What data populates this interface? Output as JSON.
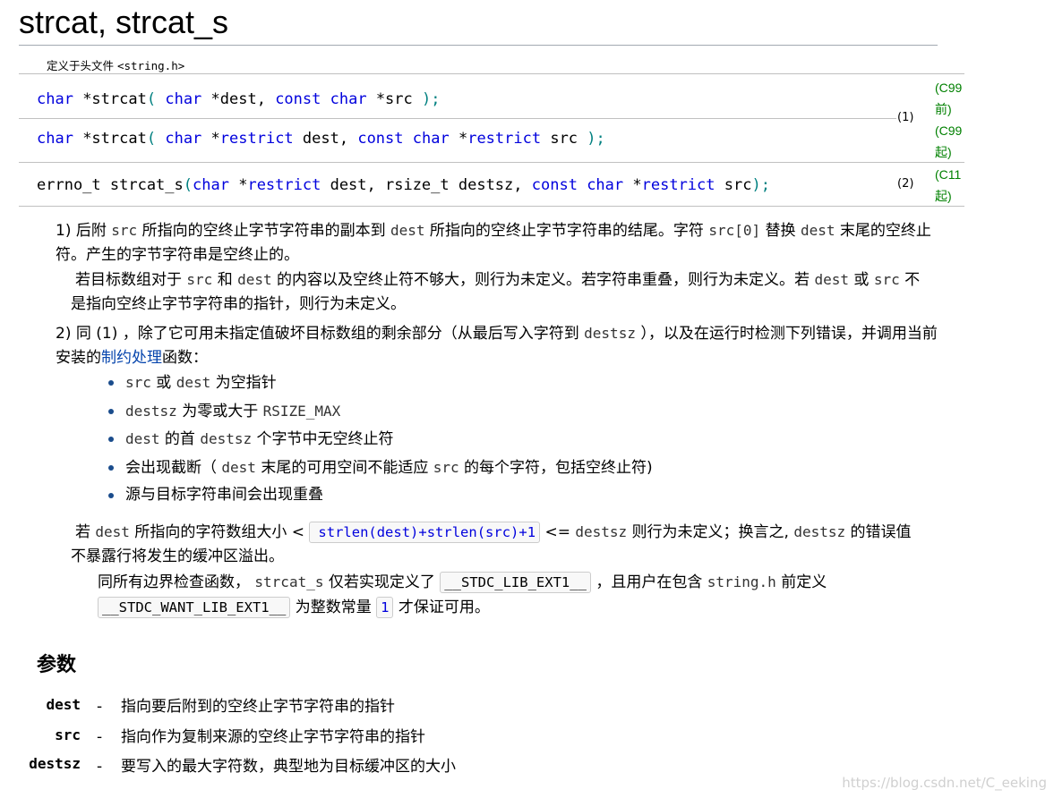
{
  "title": "strcat, strcat_s",
  "header": {
    "prefix": "定义于头文件 ",
    "file": "<string.h>"
  },
  "decls": [
    {
      "parts": [
        [
          "kw",
          "char"
        ],
        [
          "t",
          " *strcat"
        ],
        [
          "pu",
          "("
        ],
        [
          "t",
          " "
        ],
        [
          "kw",
          "char"
        ],
        [
          "t",
          " *dest, "
        ],
        [
          "kw",
          "const"
        ],
        [
          "t",
          " "
        ],
        [
          "kw",
          "char"
        ],
        [
          "t",
          " *src "
        ],
        [
          "pu",
          ");"
        ]
      ]
    },
    {
      "parts": [
        [
          "kw",
          "char"
        ],
        [
          "t",
          " *strcat"
        ],
        [
          "pu",
          "("
        ],
        [
          "t",
          " "
        ],
        [
          "kw",
          "char"
        ],
        [
          "t",
          " *"
        ],
        [
          "kw",
          "restrict"
        ],
        [
          "t",
          " dest, "
        ],
        [
          "kw",
          "const"
        ],
        [
          "t",
          " "
        ],
        [
          "kw",
          "char"
        ],
        [
          "t",
          " *"
        ],
        [
          "kw",
          "restrict"
        ],
        [
          "t",
          " src "
        ],
        [
          "pu",
          ");"
        ]
      ]
    },
    {
      "parts": [
        [
          "t",
          "errno_t strcat_s"
        ],
        [
          "pu",
          "("
        ],
        [
          "kw",
          "char"
        ],
        [
          "t",
          " *"
        ],
        [
          "kw",
          "restrict"
        ],
        [
          "t",
          " dest, rsize_t destsz, "
        ],
        [
          "kw",
          "const"
        ],
        [
          "t",
          " "
        ],
        [
          "kw",
          "char"
        ],
        [
          "t",
          " *"
        ],
        [
          "kw",
          "restrict"
        ],
        [
          "t",
          " src"
        ],
        [
          "pu",
          ");"
        ]
      ]
    }
  ],
  "decl_numbers": [
    "(1)",
    "(2)"
  ],
  "standards": [
    "(C99 前)",
    "(C99 起)",
    "(C11 起)"
  ],
  "desc1": {
    "num": "1)",
    "parts": [
      [
        "t",
        " 后附 "
      ],
      [
        "c",
        "src"
      ],
      [
        "t",
        " 所指向的空终止字节字符串的副本到 "
      ],
      [
        "c",
        "dest"
      ],
      [
        "t",
        " 所指向的空终止字节字符串的结尾。字符 "
      ],
      [
        "c",
        "src[0]"
      ],
      [
        "t",
        " 替换 "
      ],
      [
        "c",
        "dest"
      ],
      [
        "t",
        " 末尾的空终止符。产生的字节字符串是空终止的。"
      ]
    ],
    "note": [
      [
        "t",
        "若目标数组对于 "
      ],
      [
        "c",
        "src"
      ],
      [
        "t",
        " 和 "
      ],
      [
        "c",
        "dest"
      ],
      [
        "t",
        " 的内容以及空终止符不够大，则行为未定义。若字符串重叠，则行为未定义。若 "
      ],
      [
        "c",
        "dest"
      ],
      [
        "t",
        " 或 "
      ],
      [
        "c",
        "src"
      ],
      [
        "t",
        " 不是指向空终止字节字符串的指针，则行为未定义。"
      ]
    ]
  },
  "desc2": {
    "num": "2)",
    "parts": [
      [
        "t",
        " 同 (1) ，除了它可用未指定值破坏目标数组的剩余部分（从最后写入字符到 "
      ],
      [
        "c",
        "destsz"
      ],
      [
        "t",
        " ），以及在运行时检测下列错误，并调用当前安装的"
      ],
      [
        "l",
        "制约处理"
      ],
      [
        "t",
        "函数："
      ]
    ]
  },
  "bullets": [
    [
      [
        "c",
        "src"
      ],
      [
        "t",
        " 或 "
      ],
      [
        "c",
        "dest"
      ],
      [
        "t",
        " 为空指针"
      ]
    ],
    [
      [
        "c",
        "destsz"
      ],
      [
        "t",
        " 为零或大于 "
      ],
      [
        "c",
        "RSIZE_MAX"
      ]
    ],
    [
      [
        "c",
        "dest"
      ],
      [
        "t",
        " 的首 "
      ],
      [
        "c",
        "destsz"
      ],
      [
        "t",
        " 个字节中无空终止符"
      ]
    ],
    [
      [
        "t",
        "会出现截断（ "
      ],
      [
        "c",
        "dest"
      ],
      [
        "t",
        " 末尾的可用空间不能适应 "
      ],
      [
        "c",
        "src"
      ],
      [
        "t",
        " 的每个字符，包括空终止符)"
      ]
    ],
    [
      [
        "t",
        "源与目标字符串间会出现重叠"
      ]
    ]
  ],
  "note2": [
    [
      "t",
      "若 "
    ],
    [
      "c",
      "dest"
    ],
    [
      "t",
      " 所指向的字符数组大小 < "
    ],
    [
      "bx",
      "strlen(dest)+strlen(src)+1"
    ],
    [
      "t",
      " <= "
    ],
    [
      "c",
      "destsz"
    ],
    [
      "t",
      " 则行为未定义；换言之, "
    ],
    [
      "c",
      "destsz"
    ],
    [
      "t",
      " 的错误值不暴露行将发生的缓冲区溢出。"
    ]
  ],
  "note3": [
    [
      "t",
      "同所有边界检查函数， "
    ],
    [
      "c",
      "strcat_s"
    ],
    [
      "t",
      " 仅若实现定义了 "
    ],
    [
      "b",
      "__STDC_LIB_EXT1__"
    ],
    [
      "t",
      " ，且用户在包含 "
    ],
    [
      "c",
      "string.h"
    ],
    [
      "t",
      " 前定义 "
    ],
    [
      "b",
      "__STDC_WANT_LIB_EXT1__"
    ],
    [
      "t",
      " 为整数常量 "
    ],
    [
      "bx",
      "1"
    ],
    [
      "t",
      " 才保证可用。"
    ]
  ],
  "params_heading": "参数",
  "params": [
    {
      "name": "dest",
      "desc": "指向要后附到的空终止字节字符串的指针"
    },
    {
      "name": "src",
      "desc": "指向作为复制来源的空终止字节字符串的指针"
    },
    {
      "name": "destsz",
      "desc": "要写入的最大字符数，典型地为目标缓冲区的大小"
    }
  ],
  "param_dash": "-",
  "watermark": "https://blog.csdn.net/C_eeking"
}
